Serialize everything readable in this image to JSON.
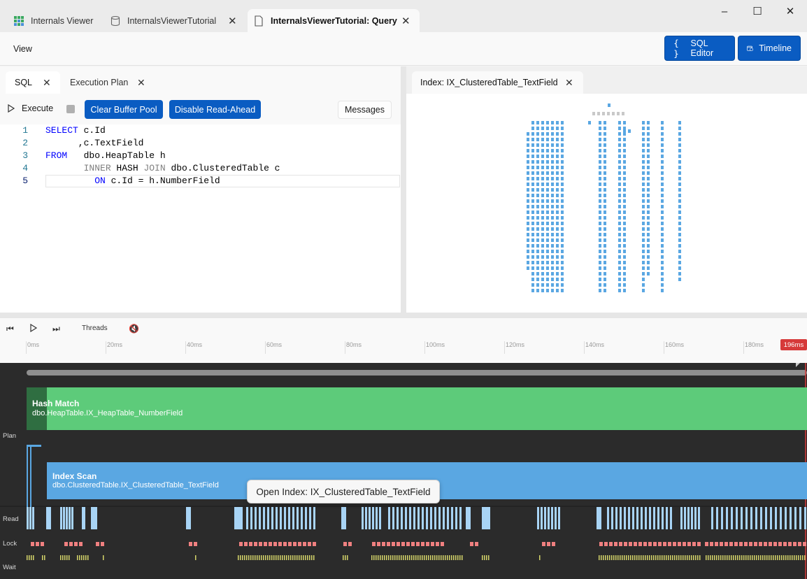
{
  "tabs": [
    {
      "label": "Internals Viewer",
      "icon": "grid-icon"
    },
    {
      "label": "InternalsViewerTutorial",
      "icon": "database-icon"
    },
    {
      "label": "InternalsViewerTutorial: Query",
      "icon": "document-icon"
    }
  ],
  "window": {
    "minimize": "–",
    "maximize": "☐",
    "close": "✕"
  },
  "menu": {
    "view": "View"
  },
  "top_buttons": {
    "sql_editor": "SQL Editor",
    "timeline": "Timeline"
  },
  "left_tabs": [
    {
      "label": "SQL"
    },
    {
      "label": "Execution Plan"
    }
  ],
  "toolbar": {
    "execute": "Execute",
    "clear_buffer_pool": "Clear Buffer Pool",
    "disable_read_ahead": "Disable Read-Ahead",
    "messages": "Messages"
  },
  "editor": {
    "line_numbers": [
      "1",
      "2",
      "3",
      "4",
      "5"
    ],
    "lines": [
      "SELECT c.Id",
      "      ,c.TextField",
      "FROM   dbo.HeapTable h",
      "       INNER HASH JOIN dbo.ClusteredTable c",
      "         ON c.Id = h.NumberField"
    ]
  },
  "right_tab": {
    "label": "Index: IX_ClusteredTable_TextField"
  },
  "timeline": {
    "threads": "Threads",
    "ticks": [
      "0ms",
      "20ms",
      "40ms",
      "60ms",
      "80ms",
      "100ms",
      "120ms",
      "140ms",
      "160ms",
      "180ms"
    ],
    "end_marker": "196ms",
    "lanes": {
      "plan": "Plan",
      "read": "Read",
      "lock": "Lock",
      "wait": "Wait"
    },
    "operators": [
      {
        "name": "Hash Match",
        "object": "dbo.HeapTable.IX_HeapTable_NumberField",
        "color": "#5dcb7a"
      },
      {
        "name": "Index Scan",
        "object": "dbo.ClusteredTable.IX_ClusteredTable_TextField",
        "color": "#5aa7e2"
      }
    ],
    "colors": {
      "read": "#a8d4f5",
      "lock": "#f08080",
      "wait": "#d4d46a",
      "accent": "#0a5cc2"
    }
  },
  "tooltip": {
    "text": "Open Index: IX_ClusteredTable_TextField"
  }
}
